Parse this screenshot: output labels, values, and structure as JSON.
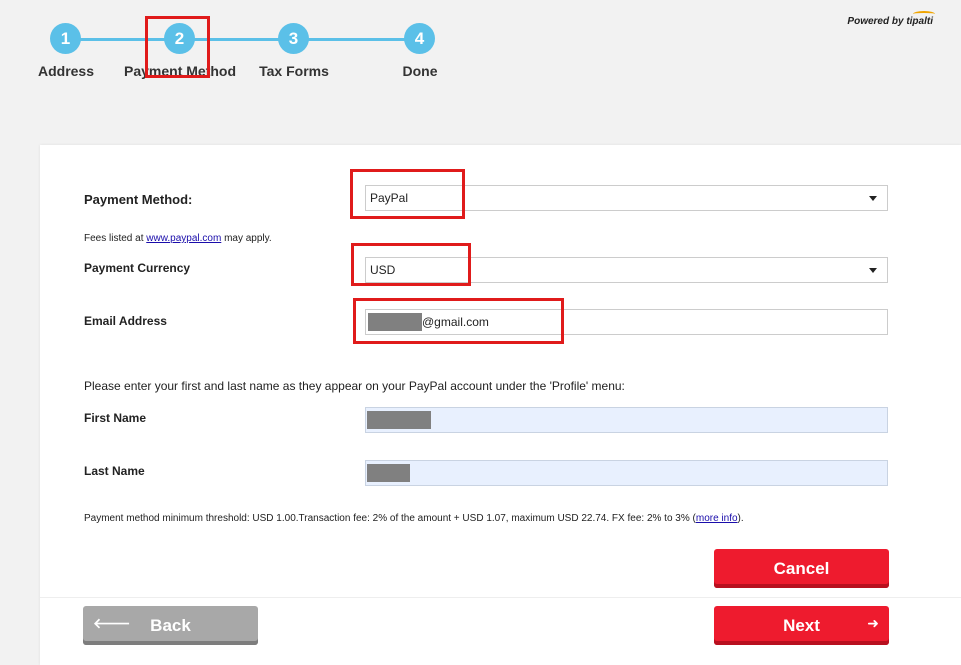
{
  "stepper": {
    "steps": [
      {
        "number": "1",
        "label": "Address"
      },
      {
        "number": "2",
        "label": "Payment Method"
      },
      {
        "number": "3",
        "label": "Tax Forms"
      },
      {
        "number": "4",
        "label": "Done"
      }
    ],
    "active_step": 2
  },
  "branding": {
    "powered_by": "Powered by ",
    "brand": "tipalti"
  },
  "form": {
    "payment_method": {
      "label": "Payment Method:",
      "value": "PayPal"
    },
    "fees_note": {
      "prefix": "Fees listed at ",
      "link": "www.paypal.com",
      "suffix": " may apply."
    },
    "payment_currency": {
      "label": "Payment Currency",
      "value": "USD"
    },
    "email": {
      "label": "Email Address",
      "value": "@gmail.com"
    },
    "name_instruction": "Please enter your first and last name as they appear on your PayPal account under the 'Profile' menu:",
    "first_name": {
      "label": "First Name"
    },
    "last_name": {
      "label": "Last Name"
    },
    "threshold_note": {
      "text": "Payment method minimum threshold: USD 1.00.Transaction fee: 2% of the amount + USD 1.07, maximum USD 22.74. FX fee: 2% to 3% (",
      "link": "more info",
      "suffix": ")."
    }
  },
  "buttons": {
    "cancel": "Cancel",
    "back": "Back",
    "next": "Next",
    "back_arrow": "🡐",
    "next_arrow": "➜"
  },
  "colors": {
    "step_blue": "#5bc0e8",
    "primary_red": "#ee1b2e",
    "highlight_red": "#e01b1b",
    "back_grey": "#a8a8a8"
  }
}
